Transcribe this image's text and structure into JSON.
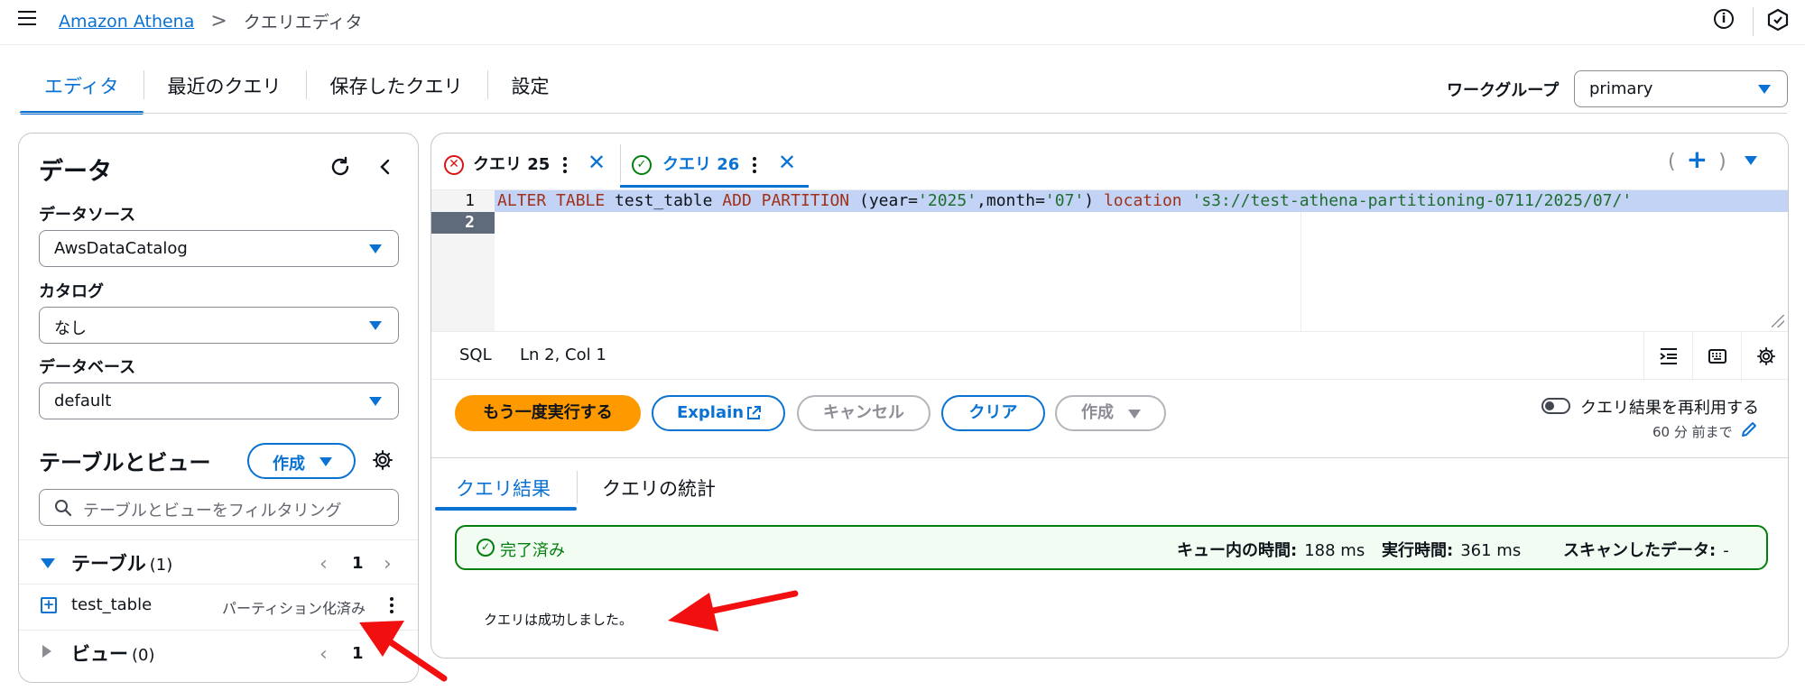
{
  "topbar": {
    "breadcrumb_link": "Amazon Athena",
    "breadcrumb_separator": ">",
    "breadcrumb_current": "クエリエディタ",
    "info_icon": "i"
  },
  "main_tabs": [
    {
      "label": "エディタ",
      "active": true
    },
    {
      "label": "最近のクエリ",
      "active": false
    },
    {
      "label": "保存したクエリ",
      "active": false
    },
    {
      "label": "設定",
      "active": false
    }
  ],
  "workgroup": {
    "label": "ワークグループ",
    "value": "primary"
  },
  "data_panel": {
    "title": "データ",
    "datasource_label": "データソース",
    "datasource_value": "AwsDataCatalog",
    "catalog_label": "カタログ",
    "catalog_value": "なし",
    "database_label": "データベース",
    "database_value": "default",
    "tables_views_title": "テーブルとビュー",
    "create_button": "作成",
    "filter_placeholder": "テーブルとビューをフィルタリング",
    "tables_section": {
      "label": "テーブル",
      "count": "(1)",
      "page": "1"
    },
    "table_item": {
      "name": "test_table",
      "badge": "パーティション化済み"
    },
    "views_section": {
      "label": "ビュー",
      "count": "(0)",
      "page": "1"
    }
  },
  "query_tabs": [
    {
      "label": "クエリ 25",
      "status": "error"
    },
    {
      "label": "クエリ 26",
      "status": "success",
      "active": true
    }
  ],
  "editor": {
    "line_numbers": [
      "1",
      "2"
    ],
    "code_line1": {
      "kw1": "ALTER TABLE",
      "t1": " test_table ",
      "kw2": "ADD PARTITION",
      "t2": " (year=",
      "s1": "'2025'",
      "t3": ",month=",
      "s2": "'07'",
      "t4": ") ",
      "kw3": "location",
      "t5": " ",
      "s3": "'s3://test-athena-partitioning-0711/2025/07/'"
    },
    "status_lang": "SQL",
    "status_pos": "Ln 2, Col 1"
  },
  "actions": {
    "run_again": "もう一度実行する",
    "explain": "Explain",
    "cancel": "キャンセル",
    "clear": "クリア",
    "create": "作成",
    "reuse_label": "クエリ結果を再利用する",
    "reuse_sub": "60 分 前まで"
  },
  "results": {
    "tabs": [
      "クエリ結果",
      "クエリの統計"
    ],
    "status": "完了済み",
    "queue_label": "キュー内の時間:",
    "queue_value": "188 ms",
    "exec_label": "実行時間:",
    "exec_value": "361 ms",
    "scan_label": "スキャンしたデータ:",
    "scan_value": "-",
    "message": "クエリは成功しました。"
  },
  "colors": {
    "accent": "#0972d3",
    "run_button": "#ff9900",
    "success": "#037f0c",
    "error": "#d91515",
    "annotation_arrow": "#f20f0f"
  }
}
